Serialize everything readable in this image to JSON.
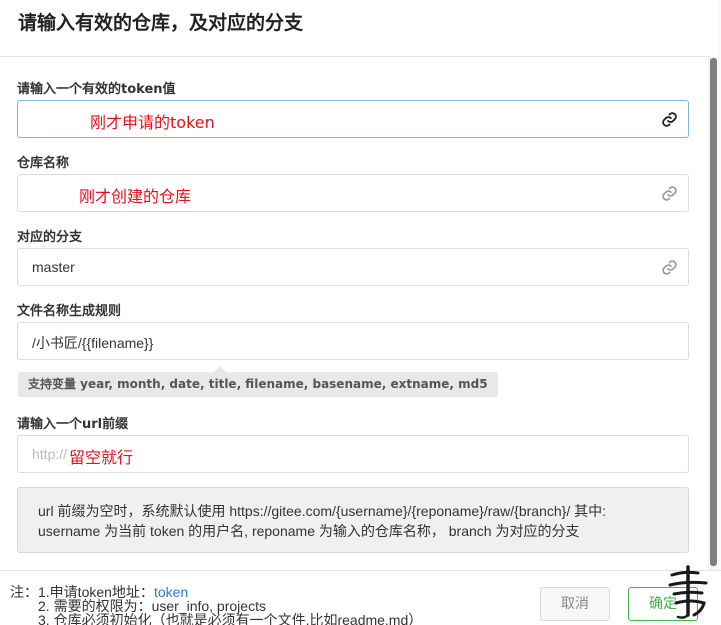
{
  "dialog": {
    "title": "请输入有效的仓库，及对应的分支"
  },
  "fields": {
    "token": {
      "label": "请输入一个有效的token值",
      "value": "",
      "annotation": "刚才申请的token"
    },
    "repo": {
      "label": "仓库名称",
      "value": "",
      "annotation": "刚才创建的仓库"
    },
    "branch": {
      "label": "对应的分支",
      "value": "master"
    },
    "filename_rule": {
      "label": "文件名称生成规则",
      "value": "/小书匠/{{filename}}",
      "tooltip": "支持变量 year, month, date, title, filename, basename, extname, md5"
    },
    "url_prefix": {
      "label": "请输入一个url前缀",
      "placeholder": "http://",
      "annotation": "留空就行"
    }
  },
  "info_box": {
    "line1": "url 前缀为空时，系统默认使用 https://gitee.com/{username}/{reponame}/raw/{branch}/ 其中:",
    "line2": "username 为当前 token 的用户名, reponame 为输入的仓库名称， branch 为对应的分支"
  },
  "footer": {
    "note_prefix": "注：1.申请token地址：",
    "token_link": "token",
    "note_2": "2. 需要的权限为：user_info, projects",
    "note_3": "3. 仓库必须初始化（也就是必须有一个文件,比如readme.md）",
    "cancel_label": "取消",
    "ok_label": "确定"
  },
  "icons": {
    "field_icon": "link-icon",
    "watermark": "calligraphy-seal-icon"
  },
  "colors": {
    "annotation_red": "#e8101a",
    "focus_border": "#7db4e0",
    "ok_green": "#43b34a",
    "link_blue": "#2f7bd1"
  }
}
